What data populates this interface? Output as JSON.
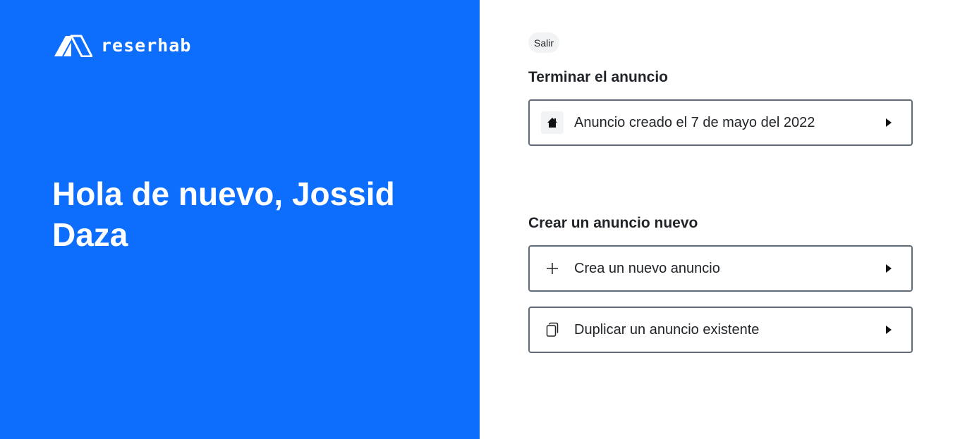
{
  "brand": {
    "name": "reserhab",
    "logo_icon": "reserhab-logo-icon"
  },
  "greeting": {
    "text": "Hola de nuevo, Jossid Daza"
  },
  "header": {
    "exit_label": "Salir"
  },
  "finish_section": {
    "title": "Terminar el anuncio",
    "items": [
      {
        "label": "Anuncio creado el 7 de mayo del 2022",
        "icon": "house-icon"
      }
    ]
  },
  "create_section": {
    "title": "Crear un anuncio nuevo",
    "items": [
      {
        "label": "Crea un nuevo anuncio",
        "icon": "plus-icon"
      },
      {
        "label": "Duplicar un anuncio existente",
        "icon": "copy-icon"
      }
    ]
  },
  "colors": {
    "primary": "#0d6efd",
    "border": "#5f6b76",
    "text": "#212529"
  }
}
